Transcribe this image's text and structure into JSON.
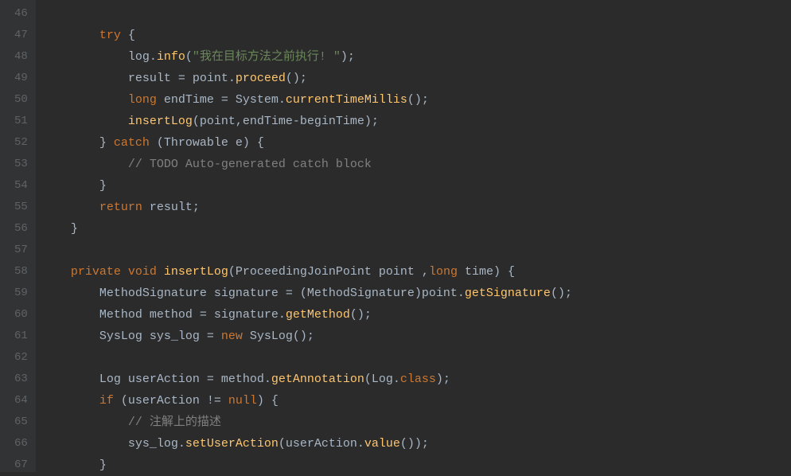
{
  "lines": [
    {
      "n": 46,
      "tokens": []
    },
    {
      "n": 47,
      "tokens": [
        {
          "t": "        ",
          "c": ""
        },
        {
          "t": "try",
          "c": "kw"
        },
        {
          "t": " {",
          "c": ""
        }
      ]
    },
    {
      "n": 48,
      "tokens": [
        {
          "t": "            log.",
          "c": ""
        },
        {
          "t": "info",
          "c": "method"
        },
        {
          "t": "(",
          "c": ""
        },
        {
          "t": "\"我在目标方法之前执行! \"",
          "c": "str"
        },
        {
          "t": ");",
          "c": ""
        }
      ]
    },
    {
      "n": 49,
      "tokens": [
        {
          "t": "            result = point.",
          "c": ""
        },
        {
          "t": "proceed",
          "c": "method"
        },
        {
          "t": "();",
          "c": ""
        }
      ]
    },
    {
      "n": 50,
      "tokens": [
        {
          "t": "            ",
          "c": ""
        },
        {
          "t": "long",
          "c": "kw"
        },
        {
          "t": " endTime = System.",
          "c": ""
        },
        {
          "t": "currentTimeMillis",
          "c": "method"
        },
        {
          "t": "();",
          "c": ""
        }
      ]
    },
    {
      "n": 51,
      "tokens": [
        {
          "t": "            ",
          "c": ""
        },
        {
          "t": "insertLog",
          "c": "method"
        },
        {
          "t": "(point,endTime-beginTime);",
          "c": ""
        }
      ]
    },
    {
      "n": 52,
      "tokens": [
        {
          "t": "        } ",
          "c": ""
        },
        {
          "t": "catch",
          "c": "kw"
        },
        {
          "t": " (Throwable e) {",
          "c": ""
        }
      ]
    },
    {
      "n": 53,
      "tokens": [
        {
          "t": "            ",
          "c": ""
        },
        {
          "t": "// ",
          "c": "cmt"
        },
        {
          "t": "TODO",
          "c": "cmt"
        },
        {
          "t": " Auto-generated catch block",
          "c": "cmt"
        }
      ]
    },
    {
      "n": 54,
      "tokens": [
        {
          "t": "        }",
          "c": ""
        }
      ]
    },
    {
      "n": 55,
      "tokens": [
        {
          "t": "        ",
          "c": ""
        },
        {
          "t": "return",
          "c": "kw"
        },
        {
          "t": " result;",
          "c": ""
        }
      ]
    },
    {
      "n": 56,
      "tokens": [
        {
          "t": "    }",
          "c": ""
        }
      ]
    },
    {
      "n": 57,
      "tokens": []
    },
    {
      "n": 58,
      "tokens": [
        {
          "t": "    ",
          "c": ""
        },
        {
          "t": "private void",
          "c": "kw"
        },
        {
          "t": " ",
          "c": ""
        },
        {
          "t": "insertLog",
          "c": "method"
        },
        {
          "t": "(ProceedingJoinPoint point ,",
          "c": ""
        },
        {
          "t": "long",
          "c": "kw"
        },
        {
          "t": " time) {",
          "c": ""
        }
      ]
    },
    {
      "n": 59,
      "tokens": [
        {
          "t": "        MethodSignature signature = (MethodSignature)point.",
          "c": ""
        },
        {
          "t": "getSignature",
          "c": "method"
        },
        {
          "t": "();",
          "c": ""
        }
      ]
    },
    {
      "n": 60,
      "tokens": [
        {
          "t": "        Method method = signature.",
          "c": ""
        },
        {
          "t": "getMethod",
          "c": "method"
        },
        {
          "t": "();",
          "c": ""
        }
      ]
    },
    {
      "n": 61,
      "tokens": [
        {
          "t": "        SysLog sys_log = ",
          "c": ""
        },
        {
          "t": "new",
          "c": "kw"
        },
        {
          "t": " SysLog();",
          "c": ""
        }
      ]
    },
    {
      "n": 62,
      "tokens": []
    },
    {
      "n": 63,
      "tokens": [
        {
          "t": "        Log userAction = method.",
          "c": ""
        },
        {
          "t": "getAnnotation",
          "c": "method"
        },
        {
          "t": "(Log.",
          "c": ""
        },
        {
          "t": "class",
          "c": "kw"
        },
        {
          "t": ");",
          "c": ""
        }
      ]
    },
    {
      "n": 64,
      "tokens": [
        {
          "t": "        ",
          "c": ""
        },
        {
          "t": "if",
          "c": "kw"
        },
        {
          "t": " (userAction != ",
          "c": ""
        },
        {
          "t": "null",
          "c": "kw"
        },
        {
          "t": ") {",
          "c": ""
        }
      ]
    },
    {
      "n": 65,
      "tokens": [
        {
          "t": "            ",
          "c": ""
        },
        {
          "t": "// 注解上的描述",
          "c": "cmt"
        }
      ]
    },
    {
      "n": 66,
      "tokens": [
        {
          "t": "            sys_log.",
          "c": ""
        },
        {
          "t": "setUserAction",
          "c": "method"
        },
        {
          "t": "(userAction.",
          "c": ""
        },
        {
          "t": "value",
          "c": "method"
        },
        {
          "t": "());",
          "c": ""
        }
      ]
    },
    {
      "n": 67,
      "tokens": [
        {
          "t": "        }",
          "c": ""
        }
      ]
    }
  ]
}
